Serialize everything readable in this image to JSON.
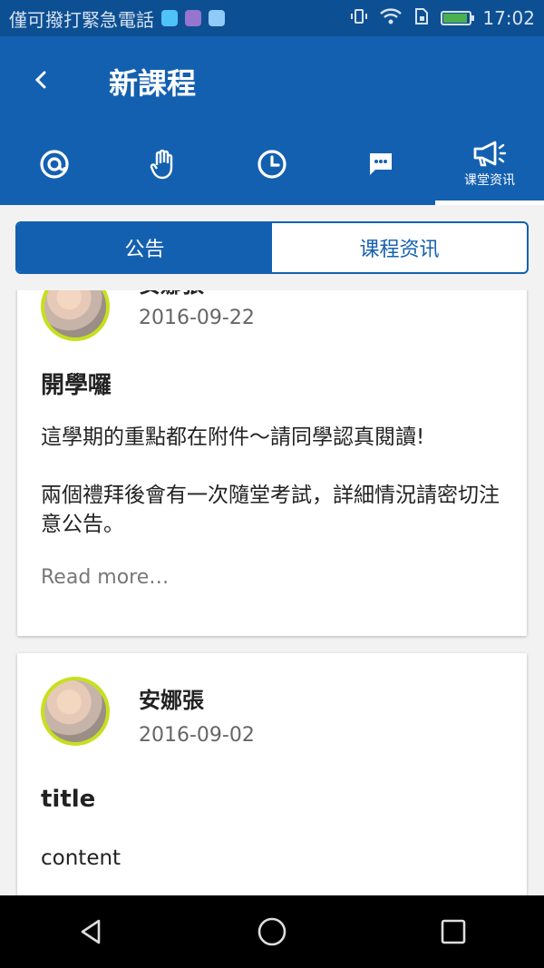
{
  "status_bar": {
    "carrier": "僅可撥打緊急電話",
    "time": "17:02"
  },
  "app_bar": {
    "title": "新課程"
  },
  "icon_tabs": [
    {
      "icon": "at-icon",
      "label": ""
    },
    {
      "icon": "hand-icon",
      "label": ""
    },
    {
      "icon": "clock-icon",
      "label": ""
    },
    {
      "icon": "chat-icon",
      "label": ""
    },
    {
      "icon": "megaphone-icon",
      "label": "课堂资讯",
      "active": true
    }
  ],
  "segment": {
    "left_label": "公告",
    "right_label": "课程资讯"
  },
  "posts": [
    {
      "author": "安娜張",
      "date": "2016-09-22",
      "title": "開學囉",
      "body_1": "這學期的重點都在附件～請同學認真閱讀!",
      "body_2": "兩個禮拜後會有一次隨堂考試，詳細情況請密切注意公告。",
      "read_more": "Read more…"
    },
    {
      "author": "安娜張",
      "date": "2016-09-02",
      "title": "title",
      "body_1": "content"
    }
  ],
  "colors": {
    "primary": "#1460b0",
    "status": "#0d4f93",
    "avatar_ring": "#c6e01e"
  }
}
